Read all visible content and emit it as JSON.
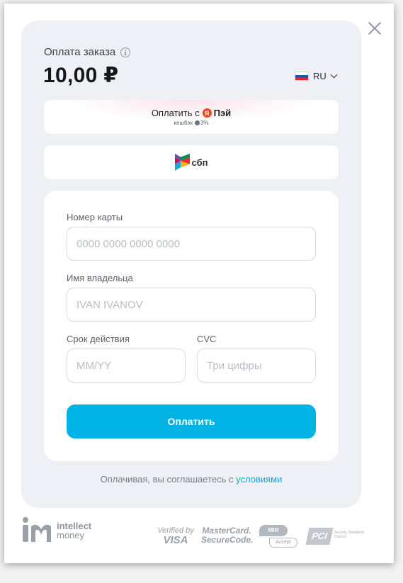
{
  "order": {
    "title": "Оплата заказа",
    "amount": "10,00 ₽"
  },
  "language": {
    "code": "RU",
    "flag_colors": [
      "#ffffff",
      "#1c57a5",
      "#e1242a"
    ]
  },
  "yandex_pay": {
    "prefix": "Оплатить с",
    "logo_letter": "Я",
    "brand": "Пэй",
    "cashback_label": "кешбэк",
    "cashback_value": "3%"
  },
  "sbp": {
    "label": "сбп"
  },
  "form": {
    "card_number_label": "Номер карты",
    "card_number_placeholder": "0000 0000 0000 0000",
    "holder_label": "Имя владельца",
    "holder_placeholder": "IVAN IVANOV",
    "expiry_label": "Срок действия",
    "expiry_placeholder": "MM/YY",
    "cvc_label": "CVC",
    "cvc_placeholder": "Три цифры",
    "pay_button": "Оплатить"
  },
  "terms": {
    "text": "Оплачивая, вы соглашаетесь с",
    "link": "условиями"
  },
  "footer": {
    "brand_line1": "intellect",
    "brand_line2": "money",
    "visa_line1": "Verified by",
    "visa_line2": "VISA",
    "mc_line1": "MasterCard.",
    "mc_line2": "SecureCode.",
    "mir_label": "MIR",
    "mir_accept": "Accept",
    "pci_label": "PCI",
    "pci_sub": "Security Standards Council"
  },
  "colors": {
    "accent": "#00b3e4",
    "link": "#1ea5d6",
    "panel": "#eef0f5",
    "yandex": "#fc3f1d"
  }
}
